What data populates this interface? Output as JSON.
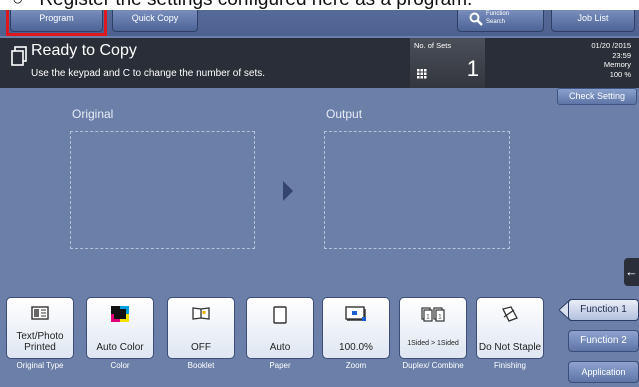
{
  "caption": "Register the settings configured here as a program.",
  "topbar": {
    "program_label": "Program",
    "quick_copy_label": "Quick Copy",
    "function_search_line1": "Function",
    "function_search_line2": "Search",
    "job_list_label": "Job List"
  },
  "status": {
    "title": "Ready to Copy",
    "message": "Use the keypad and C to change the number of sets.",
    "sets_label": "No. of Sets",
    "sets_value": "1",
    "date": "01/20 /2015",
    "time": "23:59",
    "memory_label": "Memory",
    "memory_value": "100 %"
  },
  "check_setting_label": "Check Setting",
  "main": {
    "original_label": "Original",
    "output_label": "Output"
  },
  "function_buttons": [
    {
      "value": "Text/Photo Printed",
      "caption": "Original Type",
      "icon": "original-type-icon"
    },
    {
      "value": "Auto Color",
      "caption": "Color",
      "icon": "color-icon"
    },
    {
      "value": "OFF",
      "caption": "Booklet",
      "icon": "booklet-icon"
    },
    {
      "value": "Auto",
      "caption": "Paper",
      "icon": "paper-icon"
    },
    {
      "value": "100.0%",
      "caption": "Zoom",
      "icon": "zoom-icon"
    },
    {
      "value": "1Sided > 1Sided",
      "caption": "Duplex/ Combine",
      "icon": "duplex-icon"
    },
    {
      "value": "Do Not Staple",
      "caption": "Finishing",
      "icon": "finishing-icon"
    }
  ],
  "right_buttons": {
    "function1": "Function 1",
    "function2": "Function 2",
    "application": "Application"
  },
  "colors": {
    "panel_bg": "#6b7fa8",
    "status_bg": "#2a2e38",
    "highlight": "#e0181e"
  }
}
